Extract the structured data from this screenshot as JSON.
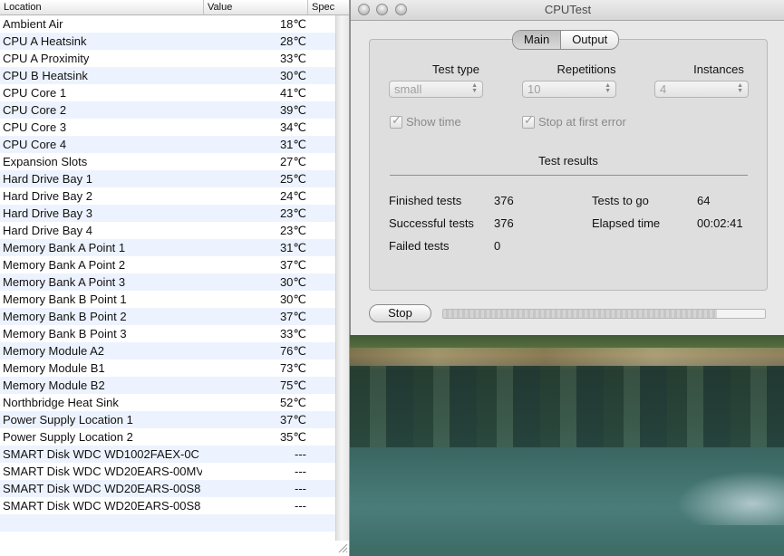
{
  "sensor_table": {
    "columns": [
      "Location",
      "Value",
      "Spec"
    ],
    "rows": [
      {
        "location": "Ambient Air",
        "value": "18℃"
      },
      {
        "location": "CPU A Heatsink",
        "value": "28℃"
      },
      {
        "location": "CPU A Proximity",
        "value": "33℃"
      },
      {
        "location": "CPU B Heatsink",
        "value": "30℃"
      },
      {
        "location": "CPU Core 1",
        "value": "41℃"
      },
      {
        "location": "CPU Core 2",
        "value": "39℃"
      },
      {
        "location": "CPU Core 3",
        "value": "34℃"
      },
      {
        "location": "CPU Core 4",
        "value": "31℃"
      },
      {
        "location": "Expansion Slots",
        "value": "27℃"
      },
      {
        "location": "Hard Drive Bay 1",
        "value": "25℃"
      },
      {
        "location": "Hard Drive Bay 2",
        "value": "24℃"
      },
      {
        "location": "Hard Drive Bay 3",
        "value": "23℃"
      },
      {
        "location": "Hard Drive Bay 4",
        "value": "23℃"
      },
      {
        "location": "Memory Bank A Point 1",
        "value": "31℃"
      },
      {
        "location": "Memory Bank A Point 2",
        "value": "37℃"
      },
      {
        "location": "Memory Bank A Point 3",
        "value": "30℃"
      },
      {
        "location": "Memory Bank B Point 1",
        "value": "30℃"
      },
      {
        "location": "Memory Bank B Point 2",
        "value": "37℃"
      },
      {
        "location": "Memory Bank B Point 3",
        "value": "33℃"
      },
      {
        "location": "Memory Module A2",
        "value": "76℃"
      },
      {
        "location": "Memory Module B1",
        "value": "73℃"
      },
      {
        "location": "Memory Module B2",
        "value": "75℃"
      },
      {
        "location": "Northbridge Heat Sink",
        "value": "52℃"
      },
      {
        "location": "Power Supply Location 1",
        "value": "37℃"
      },
      {
        "location": "Power Supply Location 2",
        "value": "35℃"
      },
      {
        "location": "SMART Disk WDC WD1002FAEX-0C",
        "value": "---"
      },
      {
        "location": "SMART Disk WDC WD20EARS-00MV",
        "value": "---"
      },
      {
        "location": "SMART Disk WDC WD20EARS-00S8",
        "value": "---"
      },
      {
        "location": "SMART Disk WDC WD20EARS-00S8",
        "value": "---"
      }
    ]
  },
  "window": {
    "title": "CPUTest",
    "tabs": [
      "Main",
      "Output"
    ],
    "test_type_label": "Test type",
    "test_type_value": "small",
    "repetitions_label": "Repetitions",
    "repetitions_value": "10",
    "instances_label": "Instances",
    "instances_value": "4",
    "show_time_label": "Show time",
    "stop_at_error_label": "Stop at first error",
    "results_title": "Test results",
    "stats": {
      "finished_label": "Finished tests",
      "finished_value": "376",
      "successful_label": "Successful tests",
      "successful_value": "376",
      "failed_label": "Failed tests",
      "failed_value": "0",
      "togo_label": "Tests to go",
      "togo_value": "64",
      "elapsed_label": "Elapsed time",
      "elapsed_value": "00:02:41"
    },
    "stop_button_label": "Stop",
    "progress_fraction": 0.85
  }
}
